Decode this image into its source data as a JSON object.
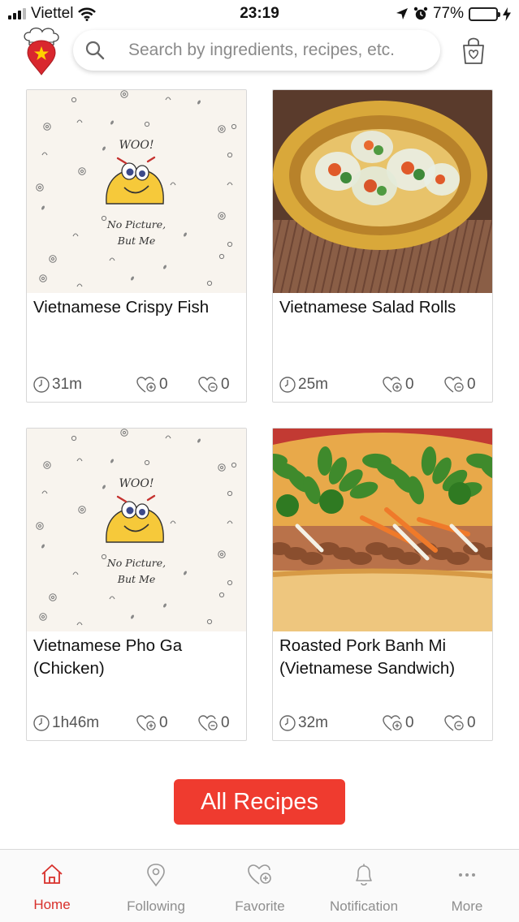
{
  "status_bar": {
    "carrier": "Viettel",
    "time": "23:19",
    "battery_percent": "77%"
  },
  "search": {
    "placeholder": "Search by ingredients, recipes, etc."
  },
  "no_picture": {
    "line1": "WOO!",
    "line2": "No Picture,",
    "line3": "But Me"
  },
  "recipes": [
    {
      "title": "Vietnamese Crispy Fish",
      "time": "31m",
      "likes": "0",
      "comments": "0",
      "image": "placeholder"
    },
    {
      "title": "Vietnamese Salad Rolls",
      "time": "25m",
      "likes": "0",
      "comments": "0",
      "image": "salad-rolls-photo"
    },
    {
      "title": "Vietnamese Pho Ga (Chicken)",
      "time": "1h46m",
      "likes": "0",
      "comments": "0",
      "image": "placeholder"
    },
    {
      "title": "Roasted Pork Banh Mi (Vietnamese Sandwich)",
      "time": "32m",
      "likes": "0",
      "comments": "0",
      "image": "banh-mi-photo"
    }
  ],
  "all_recipes_button": {
    "label": "All Recipes"
  },
  "tabs": [
    {
      "label": "Home",
      "icon": "home-icon",
      "active": true
    },
    {
      "label": "Following",
      "icon": "location-pin-icon",
      "active": false
    },
    {
      "label": "Favorite",
      "icon": "heart-plus-icon",
      "active": false
    },
    {
      "label": "Notification",
      "icon": "bell-icon",
      "active": false
    },
    {
      "label": "More",
      "icon": "more-dots-icon",
      "active": false
    }
  ],
  "colors": {
    "accent": "#ef3b2f",
    "active_tab": "#d8302b",
    "battery": "#f5c400"
  }
}
